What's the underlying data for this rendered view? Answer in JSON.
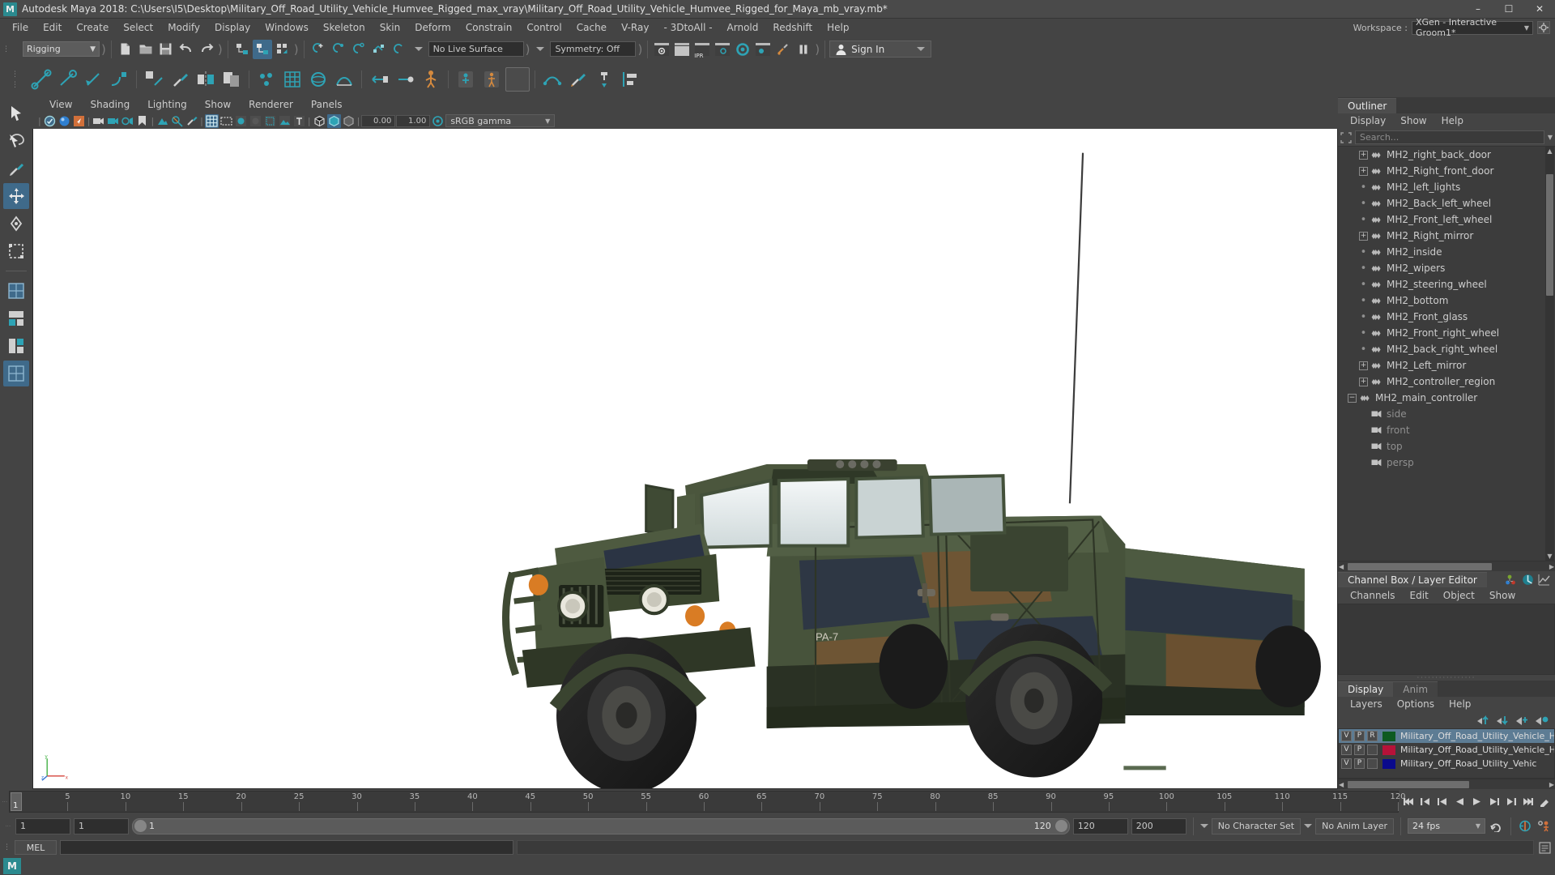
{
  "window": {
    "title": "Autodesk Maya 2018: C:\\Users\\I5\\Desktop\\Military_Off_Road_Utility_Vehicle_Humvee_Rigged_max_vray\\Military_Off_Road_Utility_Vehicle_Humvee_Rigged_for_Maya_mb_vray.mb*",
    "logo": "M",
    "minimize": "–",
    "maximize": "☐",
    "close": "✕"
  },
  "menubar": {
    "items": [
      "File",
      "Edit",
      "Create",
      "Select",
      "Modify",
      "Display",
      "Windows",
      "Skeleton",
      "Skin",
      "Deform",
      "Constrain",
      "Control",
      "Cache",
      "V-Ray",
      "- 3DtoAll -",
      "Arnold",
      "Redshift",
      "Help"
    ],
    "workspace_label": "Workspace :",
    "workspace_value": "XGen - Interactive Groom1*"
  },
  "statusline": {
    "menuset": "Rigging",
    "live_surface": "No Live Surface",
    "symmetry": "Symmetry: Off",
    "signin": "Sign In",
    "ipr_label": "IPR"
  },
  "viewport_menu": {
    "items": [
      "View",
      "Shading",
      "Lighting",
      "Show",
      "Renderer",
      "Panels"
    ]
  },
  "viewport_toolbar": {
    "exposure": "0.00",
    "gamma_value": "1.00",
    "colorspace": "sRGB gamma"
  },
  "outliner": {
    "tab": "Outliner",
    "menus": [
      "Display",
      "Show",
      "Help"
    ],
    "search_placeholder": "Search...",
    "items": [
      {
        "label": "persp",
        "indent": 1,
        "node": "leaf",
        "icon": "camera-icon",
        "dim": true
      },
      {
        "label": "top",
        "indent": 1,
        "node": "leaf",
        "icon": "camera-icon",
        "dim": true
      },
      {
        "label": "front",
        "indent": 1,
        "node": "leaf",
        "icon": "camera-icon",
        "dim": true
      },
      {
        "label": "side",
        "indent": 1,
        "node": "leaf",
        "icon": "camera-icon",
        "dim": true
      },
      {
        "label": "MH2_main_controller",
        "indent": 0,
        "node": "minus",
        "icon": "mesh-icon",
        "dim": false
      },
      {
        "label": "MH2_controller_region",
        "indent": 1,
        "node": "plus",
        "icon": "mesh-icon",
        "dim": false
      },
      {
        "label": "MH2_Left_mirror",
        "indent": 1,
        "node": "plus",
        "icon": "mesh-icon",
        "dim": false
      },
      {
        "label": "MH2_back_right_wheel",
        "indent": 1,
        "node": "leafdash",
        "icon": "mesh-icon",
        "dim": false
      },
      {
        "label": "MH2_Front_right_wheel",
        "indent": 1,
        "node": "leafdash",
        "icon": "mesh-icon",
        "dim": false
      },
      {
        "label": "MH2_Front_glass",
        "indent": 1,
        "node": "leafdash",
        "icon": "mesh-icon",
        "dim": false
      },
      {
        "label": "MH2_bottom",
        "indent": 1,
        "node": "leafdash",
        "icon": "mesh-icon",
        "dim": false
      },
      {
        "label": "MH2_steering_wheel",
        "indent": 1,
        "node": "leafdash",
        "icon": "mesh-icon",
        "dim": false
      },
      {
        "label": "MH2_wipers",
        "indent": 1,
        "node": "leafdash",
        "icon": "mesh-icon",
        "dim": false
      },
      {
        "label": "MH2_inside",
        "indent": 1,
        "node": "leafdash",
        "icon": "mesh-icon",
        "dim": false
      },
      {
        "label": "MH2_Right_mirror",
        "indent": 1,
        "node": "plus",
        "icon": "mesh-icon",
        "dim": false
      },
      {
        "label": "MH2_Front_left_wheel",
        "indent": 1,
        "node": "leafdash",
        "icon": "mesh-icon",
        "dim": false
      },
      {
        "label": "MH2_Back_left_wheel",
        "indent": 1,
        "node": "leafdash",
        "icon": "mesh-icon",
        "dim": false
      },
      {
        "label": "MH2_left_lights",
        "indent": 1,
        "node": "leafdash",
        "icon": "mesh-icon",
        "dim": false
      },
      {
        "label": "MH2_Right_front_door",
        "indent": 1,
        "node": "plus",
        "icon": "mesh-icon",
        "dim": false
      },
      {
        "label": "MH2_right_back_door",
        "indent": 1,
        "node": "plus",
        "icon": "mesh-icon",
        "dim": false
      }
    ]
  },
  "channelbox": {
    "tab": "Channel Box / Layer Editor",
    "menus": [
      "Channels",
      "Edit",
      "Object",
      "Show"
    ]
  },
  "layereditor": {
    "tabs": [
      "Display",
      "Anim"
    ],
    "active_tab": "Display",
    "menus": [
      "Layers",
      "Options",
      "Help"
    ],
    "layers": [
      {
        "v": "V",
        "p": "P",
        "r": "R",
        "color": "#0d5a20",
        "name": "Military_Off_Road_Utility_Vehicle_Hu",
        "selected": true
      },
      {
        "v": "V",
        "p": "P",
        "r": "",
        "color": "#b61239",
        "name": "Military_Off_Road_Utility_Vehicle_Hu",
        "selected": false
      },
      {
        "v": "V",
        "p": "P",
        "r": "",
        "color": "#0a0a8c",
        "name": "Military_Off_Road_Utility_Vehic",
        "selected": false
      }
    ]
  },
  "timeline": {
    "current_frame": "1",
    "ticks": [
      {
        "label": "5",
        "frame": 5
      },
      {
        "label": "10",
        "frame": 10
      },
      {
        "label": "15",
        "frame": 15
      },
      {
        "label": "20",
        "frame": 20
      },
      {
        "label": "25",
        "frame": 25
      },
      {
        "label": "30",
        "frame": 30
      },
      {
        "label": "35",
        "frame": 35
      },
      {
        "label": "40",
        "frame": 40
      },
      {
        "label": "45",
        "frame": 45
      },
      {
        "label": "50",
        "frame": 50
      },
      {
        "label": "55",
        "frame": 55
      },
      {
        "label": "60",
        "frame": 60
      },
      {
        "label": "65",
        "frame": 65
      },
      {
        "label": "70",
        "frame": 70
      },
      {
        "label": "75",
        "frame": 75
      },
      {
        "label": "80",
        "frame": 80
      },
      {
        "label": "85",
        "frame": 85
      },
      {
        "label": "90",
        "frame": 90
      },
      {
        "label": "95",
        "frame": 95
      },
      {
        "label": "100",
        "frame": 100
      },
      {
        "label": "105",
        "frame": 105
      },
      {
        "label": "110",
        "frame": 110
      },
      {
        "label": "115",
        "frame": 115
      },
      {
        "label": "120",
        "frame": 120
      }
    ],
    "range_field": "1",
    "range_min": "1",
    "range_start": "1",
    "range_end": "120",
    "anim_end": "120",
    "playback_end": "200",
    "character_set": "No Character Set",
    "anim_layer": "No Anim Layer",
    "fps": "24 fps"
  },
  "commandline": {
    "mel_label": "MEL"
  }
}
